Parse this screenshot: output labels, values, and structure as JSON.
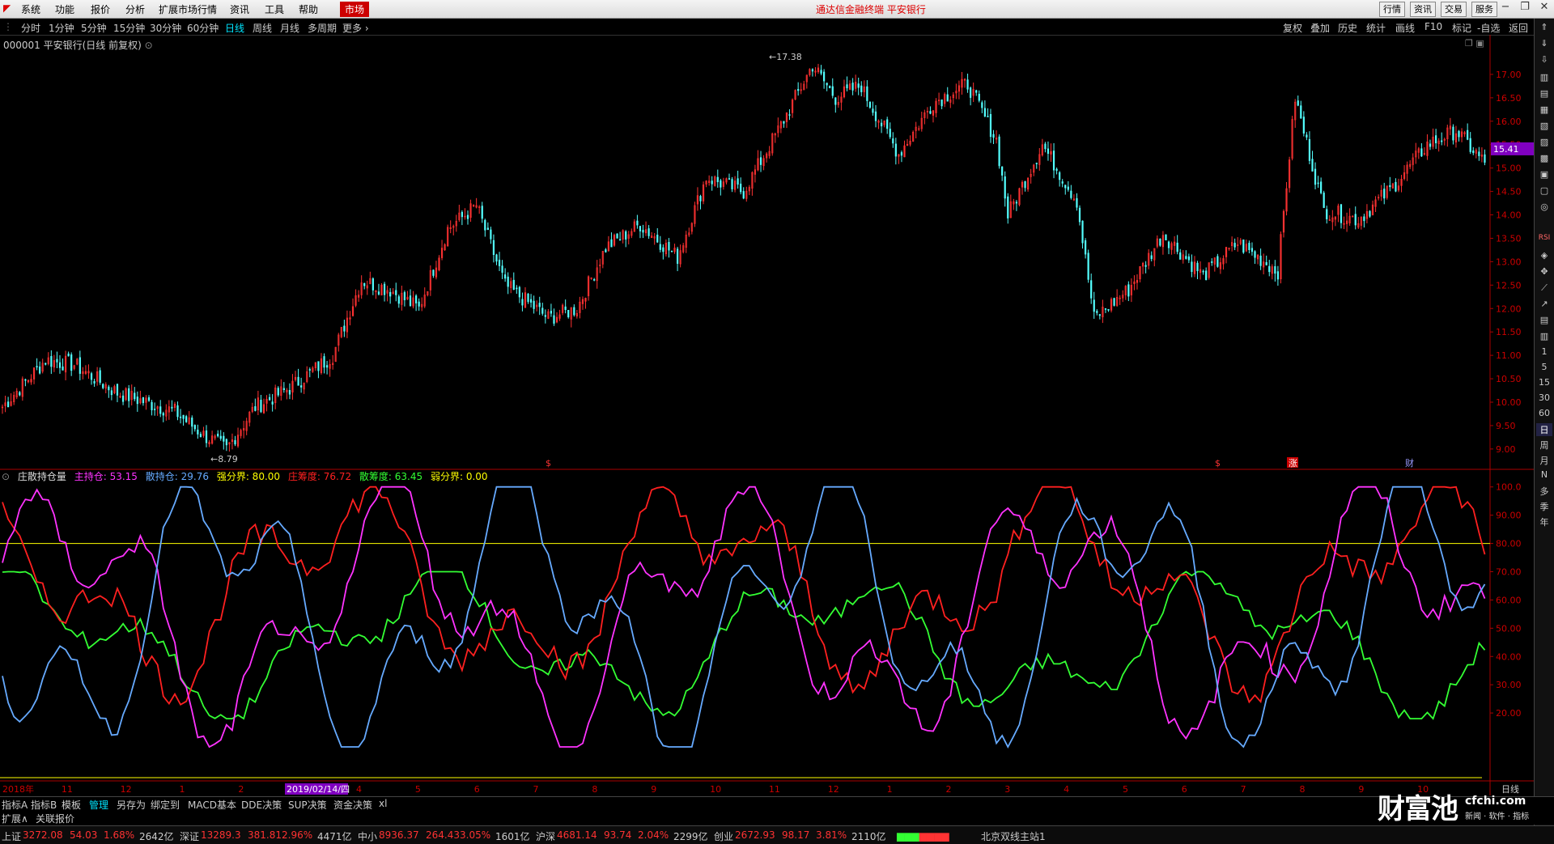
{
  "menubar": {
    "items": [
      "系统",
      "功能",
      "报价",
      "分析",
      "扩展市场行情",
      "资讯",
      "工具",
      "帮助"
    ],
    "active": "市场",
    "center_title": "通达信金融终端  平安银行",
    "right_buttons": [
      "行情",
      "资讯",
      "交易",
      "服务"
    ]
  },
  "periodbar": {
    "periods": [
      "分时",
      "1分钟",
      "5分钟",
      "15分钟",
      "30分钟",
      "60分钟",
      "日线",
      "周线",
      "月线",
      "多周期",
      "更多"
    ],
    "selected": "日线",
    "right_tools": [
      "复权",
      "叠加",
      "历史",
      "统计",
      "画线",
      "F10",
      "标记",
      "-自选",
      "返回"
    ]
  },
  "stock": {
    "title": "000001 平安银行(日线 前复权)",
    "high_label": "17.38",
    "low_label": "8.79",
    "last_price": "15.41"
  },
  "price_axis": [
    "17.00",
    "16.50",
    "16.00",
    "15.50",
    "15.00",
    "14.50",
    "14.00",
    "13.50",
    "13.00",
    "12.50",
    "12.00",
    "11.50",
    "11.00",
    "10.50",
    "10.00",
    "9.50",
    "9.00"
  ],
  "event_marks": [
    {
      "text": "$",
      "color": "#ff3333"
    },
    {
      "text": "$",
      "color": "#ff3333"
    },
    {
      "text": "涨",
      "color": "#ffffff",
      "bg": "#c00"
    },
    {
      "text": "财",
      "color": "#9999ff"
    }
  ],
  "indicator": {
    "name": "庄散持仓量",
    "legend": [
      {
        "label": "主持仓: 53.15",
        "color": "#ff33ff"
      },
      {
        "label": "散持仓: 29.76",
        "color": "#66aaff"
      },
      {
        "label": "强分界: 80.00",
        "color": "#ffff00"
      },
      {
        "label": "庄筹度: 76.72",
        "color": "#ff2020"
      },
      {
        "label": "散筹度: 63.45",
        "color": "#33ff33"
      },
      {
        "label": "弱分界: 0.00",
        "color": "#ffff00"
      }
    ],
    "axis": [
      "100.0",
      "90.00",
      "80.00",
      "70.00",
      "60.00",
      "50.00",
      "40.00",
      "30.00",
      "20.00"
    ]
  },
  "date_axis": {
    "labels": [
      "2018年",
      "11",
      "12",
      "1",
      "2",
      "3",
      "4",
      "5",
      "6",
      "7",
      "8",
      "9",
      "10",
      "11",
      "12",
      "1",
      "2",
      "3",
      "4",
      "5",
      "6",
      "7",
      "8",
      "9",
      "10"
    ],
    "highlight": "2019/02/14/四",
    "period": "日线"
  },
  "sidebar": {
    "labels": [
      "1",
      "5",
      "15",
      "30",
      "60",
      "日",
      "周",
      "月",
      "N",
      "多",
      "季",
      "年"
    ],
    "selected": "日"
  },
  "bottomtabs": {
    "items": [
      "指标A",
      "指标B",
      "模板",
      "管理",
      "另存为",
      "绑定到",
      "MACD基本",
      "DDE决策",
      "SUP决策",
      "资金决策",
      "xl"
    ],
    "selected": "管理"
  },
  "bottomtabs2": {
    "items": [
      "扩展∧",
      "关联报价"
    ]
  },
  "statusbar": {
    "indices": [
      {
        "name": "上证",
        "value": "3272.08",
        "change": "54.03",
        "pct": "1.68%",
        "volume": "2642亿"
      },
      {
        "name": "深证",
        "value": "13289.3",
        "change": "381.81",
        "pct": "2.96%",
        "volume": "4471亿"
      },
      {
        "name": "中小",
        "value": "8936.37",
        "change": "264.43",
        "pct": "3.05%",
        "volume": "1601亿"
      },
      {
        "name": "沪深",
        "value": "4681.14",
        "change": "93.74",
        "pct": "2.04%",
        "volume": "2299亿"
      },
      {
        "name": "创业",
        "value": "2672.93",
        "change": "98.17",
        "pct": "3.81%",
        "volume": "2110亿"
      }
    ],
    "server": "北京双线主站1"
  },
  "watermark": {
    "brand": "财富池",
    "site": "cfchi.com",
    "slogan": "新闻 · 软件 · 指标"
  },
  "colors": {
    "up": "#ff3232",
    "down": "#54ffff",
    "bg": "#000000",
    "grid": "#7a0000",
    "accent": "#00e5ff"
  }
}
